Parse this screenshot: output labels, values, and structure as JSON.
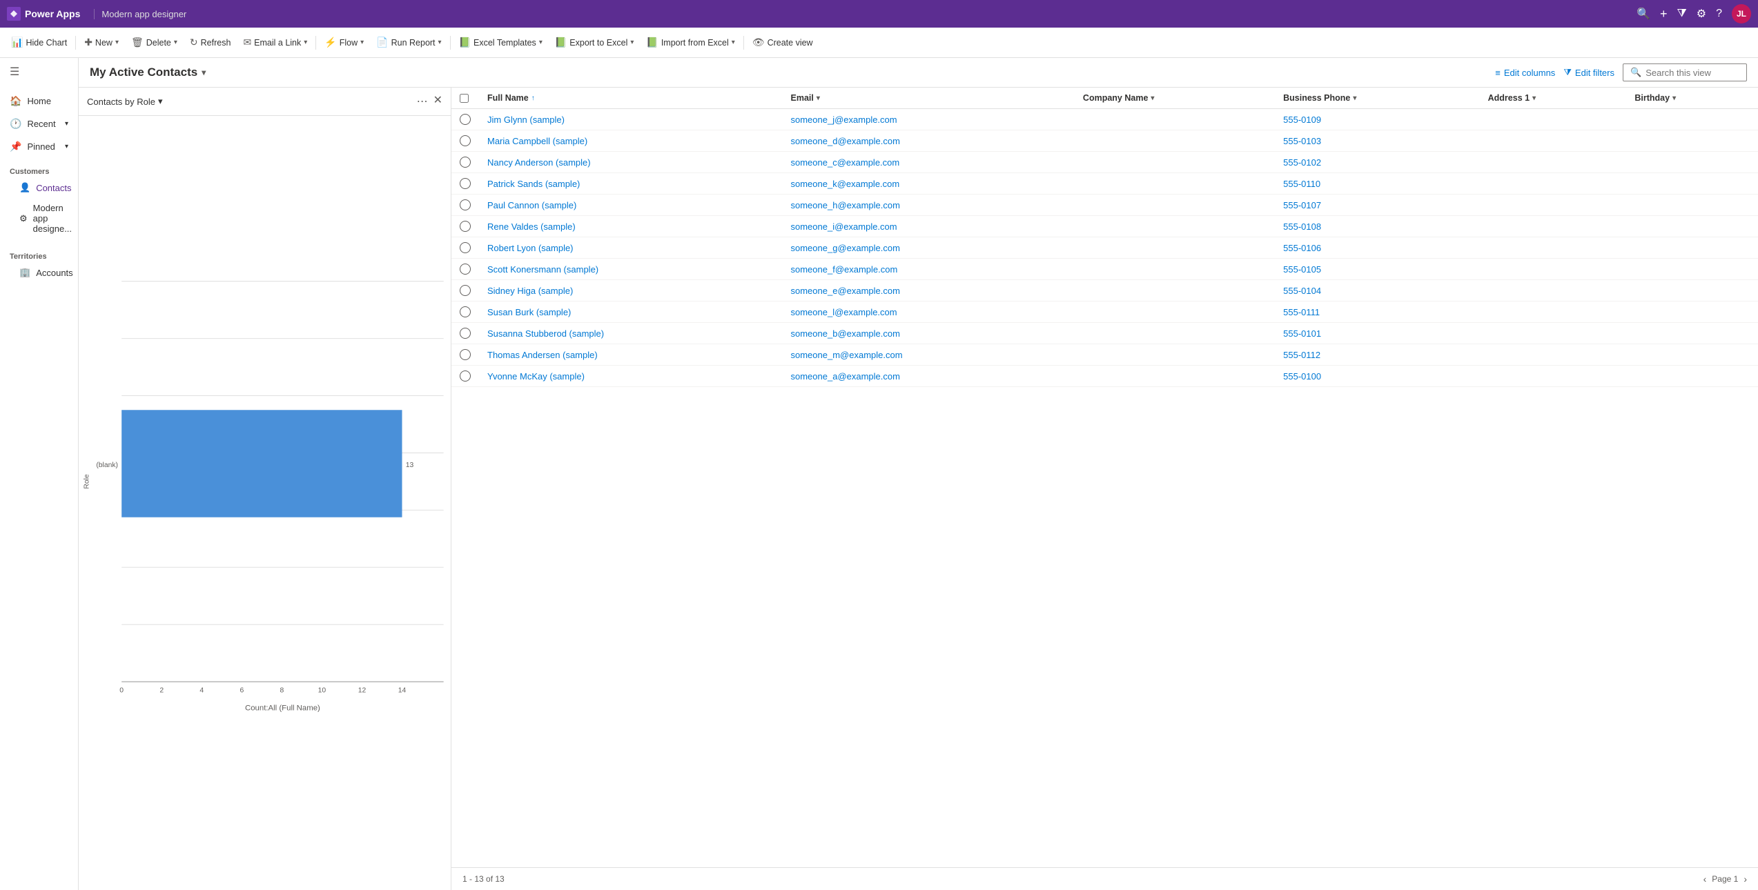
{
  "topbar": {
    "logo_text": "Power Apps",
    "app_name": "Modern app designer",
    "avatar_initials": "JL",
    "icons": {
      "search": "🔍",
      "add": "+",
      "filter": "⧩",
      "settings": "⚙",
      "help": "?"
    }
  },
  "commandbar": {
    "buttons": [
      {
        "id": "hide-chart",
        "icon": "📊",
        "label": "Hide Chart",
        "has_dropdown": false
      },
      {
        "id": "new",
        "icon": "+",
        "label": "New",
        "has_dropdown": true
      },
      {
        "id": "delete",
        "icon": "🗑",
        "label": "Delete",
        "has_dropdown": true
      },
      {
        "id": "refresh",
        "icon": "↻",
        "label": "Refresh",
        "has_dropdown": false
      },
      {
        "id": "email-link",
        "icon": "✉",
        "label": "Email a Link",
        "has_dropdown": true
      },
      {
        "id": "flow",
        "icon": "⚡",
        "label": "Flow",
        "has_dropdown": true
      },
      {
        "id": "run-report",
        "icon": "📄",
        "label": "Run Report",
        "has_dropdown": true
      },
      {
        "id": "excel-templates",
        "icon": "📗",
        "label": "Excel Templates",
        "has_dropdown": true
      },
      {
        "id": "export-excel",
        "icon": "📗",
        "label": "Export to Excel",
        "has_dropdown": true
      },
      {
        "id": "import-excel",
        "icon": "📗",
        "label": "Import from Excel",
        "has_dropdown": true
      },
      {
        "id": "create-view",
        "icon": "👁",
        "label": "Create view",
        "has_dropdown": false
      }
    ]
  },
  "sidebar": {
    "home_label": "Home",
    "recent_label": "Recent",
    "pinned_label": "Pinned",
    "customers_group": "Customers",
    "contacts_label": "Contacts",
    "modern_app_label": "Modern app designe...",
    "territories_group": "Territories",
    "accounts_label": "Accounts"
  },
  "view": {
    "title": "My Active Contacts",
    "edit_columns_label": "Edit columns",
    "edit_filters_label": "Edit filters",
    "search_placeholder": "Search this view"
  },
  "chart": {
    "title": "Contacts by Role",
    "bar_data": [
      {
        "label": "(blank)",
        "value": 13,
        "height_pct": 85
      }
    ],
    "x_axis_label": "Count:All (Full Name)",
    "x_ticks": [
      "0",
      "2",
      "4",
      "6",
      "8",
      "10",
      "12",
      "14"
    ],
    "y_labels": [
      "Role"
    ],
    "blank_label": "(blank)",
    "count_label": "13"
  },
  "table": {
    "columns": [
      {
        "id": "full-name",
        "label": "Full Name",
        "sorted": true,
        "sort_dir": "asc"
      },
      {
        "id": "email",
        "label": "Email",
        "sorted": false
      },
      {
        "id": "company-name",
        "label": "Company Name",
        "sorted": false
      },
      {
        "id": "business-phone",
        "label": "Business Phone",
        "sorted": false
      },
      {
        "id": "address1",
        "label": "Address 1",
        "sorted": false
      },
      {
        "id": "birthday",
        "label": "Birthday",
        "sorted": false
      }
    ],
    "rows": [
      {
        "full_name": "Jim Glynn (sample)",
        "email": "someone_j@example.com",
        "company": "",
        "phone": "555-0109",
        "address": "",
        "birthday": ""
      },
      {
        "full_name": "Maria Campbell (sample)",
        "email": "someone_d@example.com",
        "company": "",
        "phone": "555-0103",
        "address": "",
        "birthday": ""
      },
      {
        "full_name": "Nancy Anderson (sample)",
        "email": "someone_c@example.com",
        "company": "",
        "phone": "555-0102",
        "address": "",
        "birthday": ""
      },
      {
        "full_name": "Patrick Sands (sample)",
        "email": "someone_k@example.com",
        "company": "",
        "phone": "555-0110",
        "address": "",
        "birthday": ""
      },
      {
        "full_name": "Paul Cannon (sample)",
        "email": "someone_h@example.com",
        "company": "",
        "phone": "555-0107",
        "address": "",
        "birthday": ""
      },
      {
        "full_name": "Rene Valdes (sample)",
        "email": "someone_i@example.com",
        "company": "",
        "phone": "555-0108",
        "address": "",
        "birthday": ""
      },
      {
        "full_name": "Robert Lyon (sample)",
        "email": "someone_g@example.com",
        "company": "",
        "phone": "555-0106",
        "address": "",
        "birthday": ""
      },
      {
        "full_name": "Scott Konersmann (sample)",
        "email": "someone_f@example.com",
        "company": "",
        "phone": "555-0105",
        "address": "",
        "birthday": ""
      },
      {
        "full_name": "Sidney Higa (sample)",
        "email": "someone_e@example.com",
        "company": "",
        "phone": "555-0104",
        "address": "",
        "birthday": ""
      },
      {
        "full_name": "Susan Burk (sample)",
        "email": "someone_l@example.com",
        "company": "",
        "phone": "555-0111",
        "address": "",
        "birthday": ""
      },
      {
        "full_name": "Susanna Stubberod (sample)",
        "email": "someone_b@example.com",
        "company": "",
        "phone": "555-0101",
        "address": "",
        "birthday": ""
      },
      {
        "full_name": "Thomas Andersen (sample)",
        "email": "someone_m@example.com",
        "company": "",
        "phone": "555-0112",
        "address": "",
        "birthday": ""
      },
      {
        "full_name": "Yvonne McKay (sample)",
        "email": "someone_a@example.com",
        "company": "",
        "phone": "555-0100",
        "address": "",
        "birthday": ""
      }
    ],
    "footer_text": "1 - 13 of 13",
    "page_label": "Page 1"
  }
}
